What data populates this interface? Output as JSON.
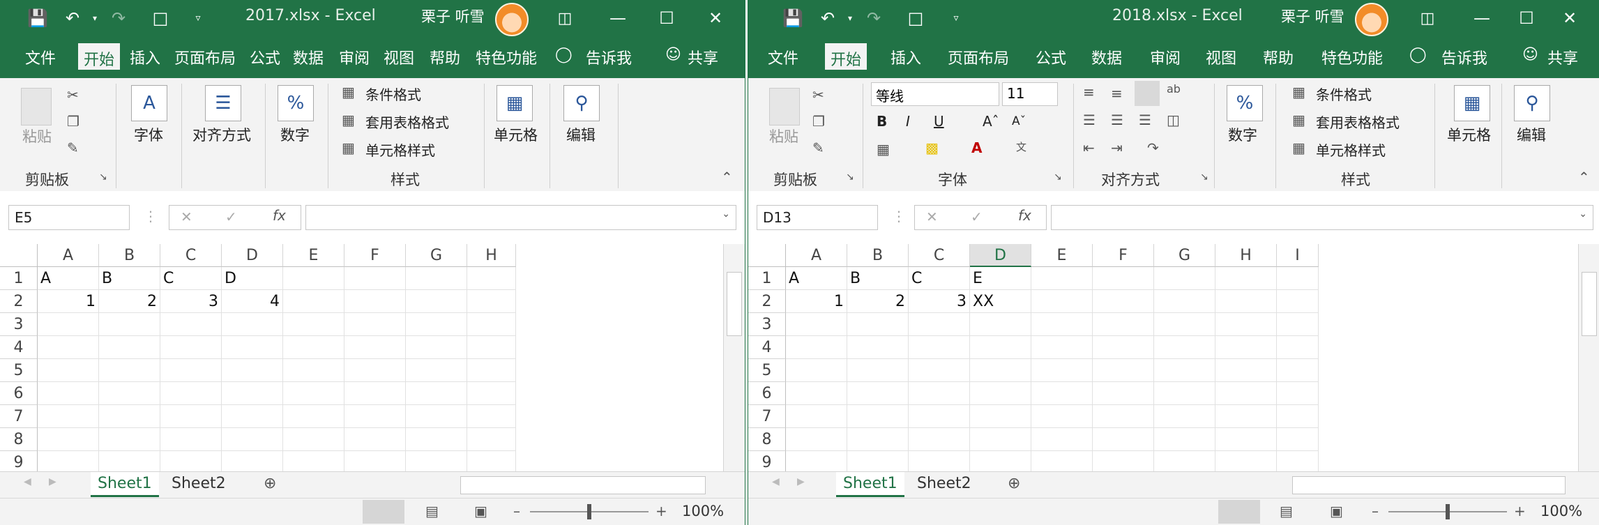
{
  "left": {
    "title": "2017.xlsx  -  Excel",
    "user": "栗子 听雪",
    "tabs": [
      "文件",
      "开始",
      "插入",
      "页面布局",
      "公式",
      "数据",
      "审阅",
      "视图",
      "帮助",
      "特色功能",
      "告诉我",
      "共享"
    ],
    "ribbon": {
      "paste": "粘贴",
      "clipboard": "剪贴板",
      "font": "字体",
      "align": "对齐方式",
      "number": "数字",
      "cond_format": "条件格式",
      "table_format": "套用表格格式",
      "cell_style": "单元格样式",
      "styles": "样式",
      "cells": "单元格",
      "edit": "编辑"
    },
    "namebox": "E5",
    "columns": [
      "A",
      "B",
      "C",
      "D",
      "E",
      "F",
      "G",
      "H"
    ],
    "rows": [
      "1",
      "2",
      "3",
      "4",
      "5",
      "6",
      "7",
      "8",
      "9"
    ],
    "cells": {
      "A1": "A",
      "B1": "B",
      "C1": "C",
      "D1": "D",
      "A2": "1",
      "B2": "2",
      "C2": "3",
      "D2": "4"
    },
    "sheets": [
      "Sheet1",
      "Sheet2"
    ],
    "zoom": "100%"
  },
  "right": {
    "title": "2018.xlsx  -  Excel",
    "user": "栗子 听雪",
    "tabs": [
      "文件",
      "开始",
      "插入",
      "页面布局",
      "公式",
      "数据",
      "审阅",
      "视图",
      "帮助",
      "特色功能",
      "告诉我",
      "共享"
    ],
    "ribbon": {
      "paste": "粘贴",
      "clipboard": "剪贴板",
      "font_name": "等线",
      "font_size": "11",
      "font": "字体",
      "align": "对齐方式",
      "number": "数字",
      "cond_format": "条件格式",
      "table_format": "套用表格格式",
      "cell_style": "单元格样式",
      "styles": "样式",
      "cells": "单元格",
      "edit": "编辑"
    },
    "namebox": "D13",
    "columns": [
      "A",
      "B",
      "C",
      "D",
      "E",
      "F",
      "G",
      "H",
      "I"
    ],
    "rows": [
      "1",
      "2",
      "3",
      "4",
      "5",
      "6",
      "7",
      "8",
      "9"
    ],
    "cells": {
      "A1": "A",
      "B1": "B",
      "C1": "C",
      "D1": "E",
      "A2": "1",
      "B2": "2",
      "C2": "3",
      "D2": "XX"
    },
    "sheets": [
      "Sheet1",
      "Sheet2"
    ],
    "zoom": "100%"
  },
  "colors": {
    "excel_green": "#217346",
    "ribbon_bg": "#f3f3f3"
  }
}
